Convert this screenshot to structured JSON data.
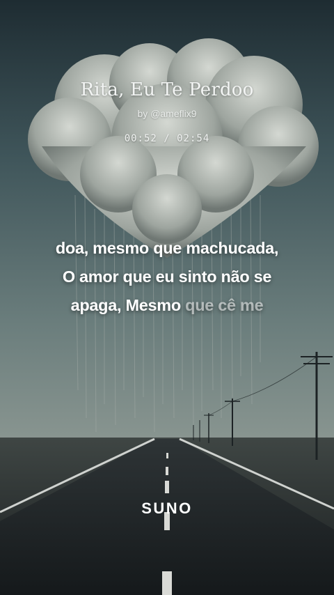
{
  "song": {
    "title": "Rita, Eu Te Perdoo",
    "artist": "by @ameflix9",
    "time": "00:52 / 02:54"
  },
  "lyrics": {
    "line1": "doa, mesmo que machucada,",
    "line2": "O amor que eu sinto não se",
    "line3_sung": "apaga, Mesmo",
    "line3_upcoming": "que cê me"
  },
  "brand": {
    "logo": "SUNO"
  },
  "colors": {
    "text": "#ffffff",
    "sky": "#5e7375",
    "road": "#1f2426"
  }
}
